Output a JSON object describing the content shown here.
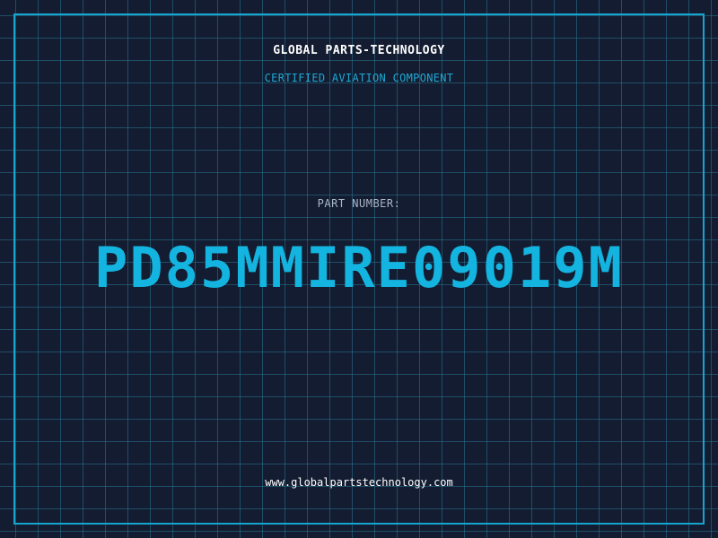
{
  "header": {
    "company": "GLOBAL PARTS-TECHNOLOGY",
    "subtitle": "CERTIFIED AVIATION COMPONENT"
  },
  "part": {
    "label": "PART NUMBER:",
    "number": "PD85MMIRE09019M"
  },
  "footer": {
    "website": "www.globalpartstechnology.com"
  },
  "colors": {
    "background": "#131c30",
    "grid": "#287696",
    "accent": "#15a5cf",
    "text": "#ffffff",
    "muted": "#a9b6c8"
  }
}
